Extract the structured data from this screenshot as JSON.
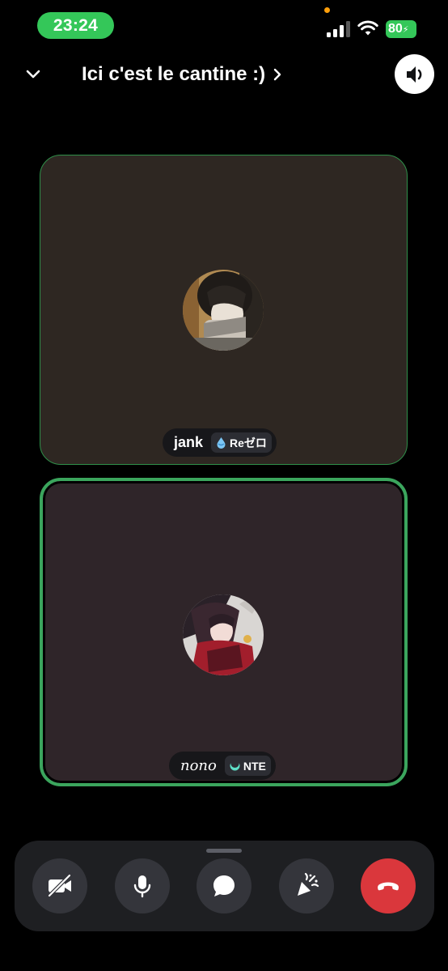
{
  "status_bar": {
    "time": "23:24",
    "battery": "80",
    "icons": [
      "signal-icon",
      "wifi-icon",
      "battery-charging-icon"
    ]
  },
  "header": {
    "channel_name": "Ici c'est le cantine :)",
    "icons": [
      "chevron-down-icon",
      "chevron-right-icon",
      "speaker-icon"
    ]
  },
  "participants": [
    {
      "name": "jank",
      "tag": "Reゼロ",
      "tag_icon": "water-drop-icon",
      "speaking": false
    },
    {
      "name": "nono",
      "tag": "NTE",
      "tag_icon": "crescent-moon-icon",
      "speaking": true
    }
  ],
  "controls": [
    {
      "name": "camera-off",
      "icon": "camera-off-icon"
    },
    {
      "name": "microphone",
      "icon": "microphone-icon"
    },
    {
      "name": "chat",
      "icon": "chat-bubble-icon"
    },
    {
      "name": "activities",
      "icon": "party-popper-icon"
    },
    {
      "name": "disconnect",
      "icon": "hang-up-icon"
    }
  ],
  "colors": {
    "background": "#000000",
    "speaking_ring": "#3ba55d",
    "status_green": "#34c759",
    "hangup_red": "#da373c",
    "control_bg": "#34353b"
  }
}
